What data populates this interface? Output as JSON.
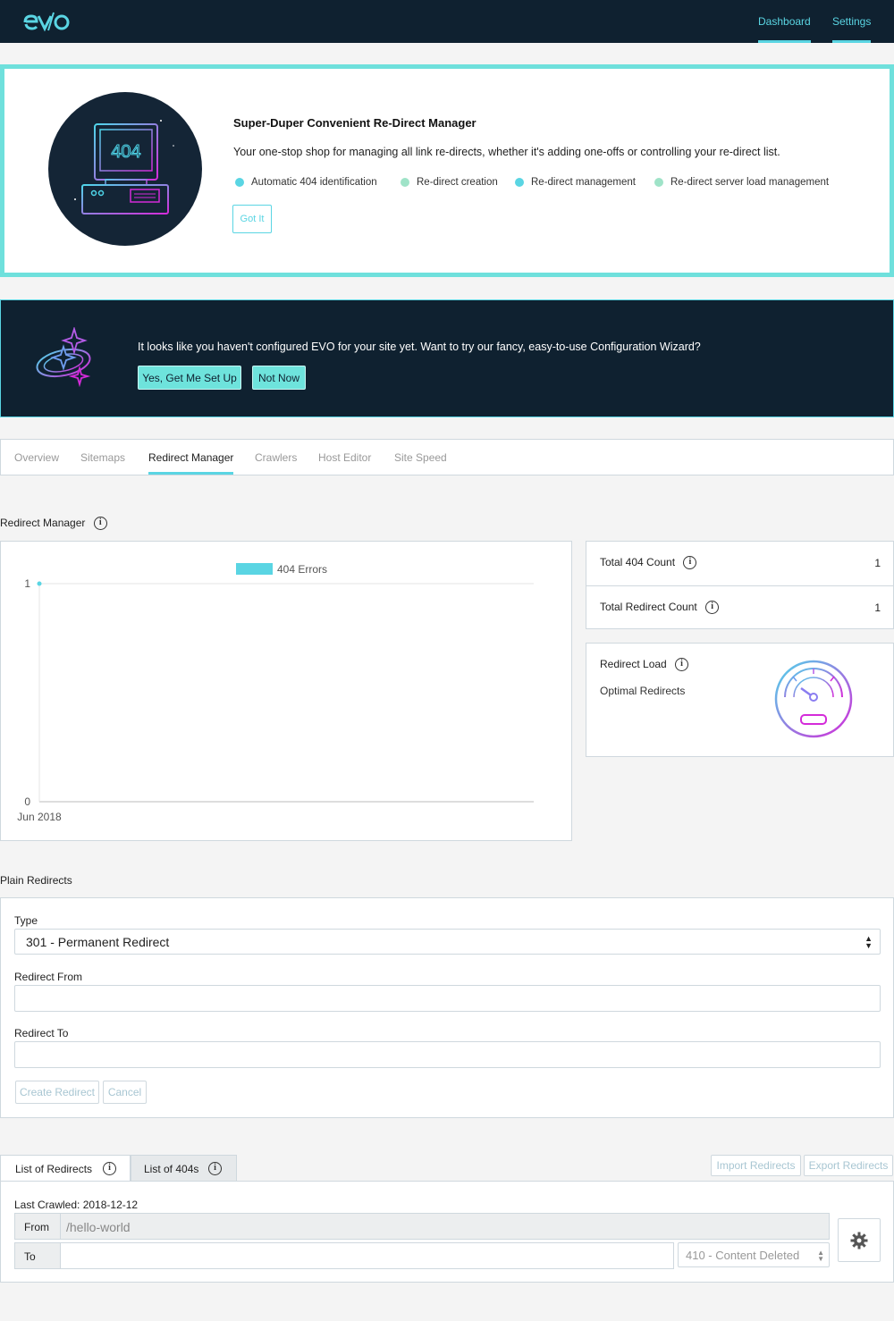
{
  "nav": {
    "logo": "evo",
    "links": [
      "Dashboard",
      "Settings"
    ]
  },
  "intro": {
    "badge_text": "404",
    "title": "Super-Duper Convenient Re-Direct Manager",
    "description": "Your one-stop shop for managing all link re-directs, whether it's adding one-offs or controlling your re-direct list.",
    "features": [
      {
        "label": "Automatic 404 identification",
        "color": "#5ad5e3"
      },
      {
        "label": "Re-direct creation",
        "color": "#9fe3c8"
      },
      {
        "label": "Re-direct management",
        "color": "#5ad5e3"
      },
      {
        "label": "Re-direct server load management",
        "color": "#9fe3c8"
      }
    ],
    "button": "Got It"
  },
  "wizard": {
    "text": "It looks like you haven't configured EVO for your site yet. Want to try our fancy, easy-to-use Configuration Wizard?",
    "yes_button": "Yes, Get Me Set Up",
    "no_button": "Not Now"
  },
  "tabs": [
    "Overview",
    "Sitemaps",
    "Redirect Manager",
    "Crawlers",
    "Host Editor",
    "Site Speed"
  ],
  "active_tab": "Redirect Manager",
  "redirect_manager": {
    "title": "Redirect Manager"
  },
  "chart_data": {
    "type": "line",
    "legend": "404 Errors",
    "x": [
      "Jun 2018"
    ],
    "series": [
      {
        "name": "404 Errors",
        "values": [
          1
        ]
      }
    ],
    "ylim": [
      0,
      1
    ],
    "y_ticks": [
      "1",
      "0"
    ],
    "x_ticks": [
      "Jun 2018"
    ],
    "color": "#5ad5e3"
  },
  "stats": [
    {
      "label": "Total 404 Count",
      "value": "1"
    },
    {
      "label": "Total Redirect Count",
      "value": "1"
    }
  ],
  "load": {
    "title": "Redirect Load",
    "status": "Optimal Redirects"
  },
  "plain": {
    "title": "Plain Redirects",
    "type_label": "Type",
    "type_value": "301 - Permanent Redirect",
    "from_label": "Redirect From",
    "to_label": "Redirect To",
    "create_button": "Create Redirect",
    "cancel_button": "Cancel"
  },
  "lists": {
    "tab_redirects": "List of Redirects",
    "tab_404s": "List of 404s",
    "import_button": "Import Redirects",
    "export_button": "Export Redirects",
    "last_crawled": "Last Crawled: 2018-12-12",
    "from_label": "From",
    "from_value": "/hello-world",
    "to_label": "To",
    "status_select": "410 - Content Deleted"
  }
}
